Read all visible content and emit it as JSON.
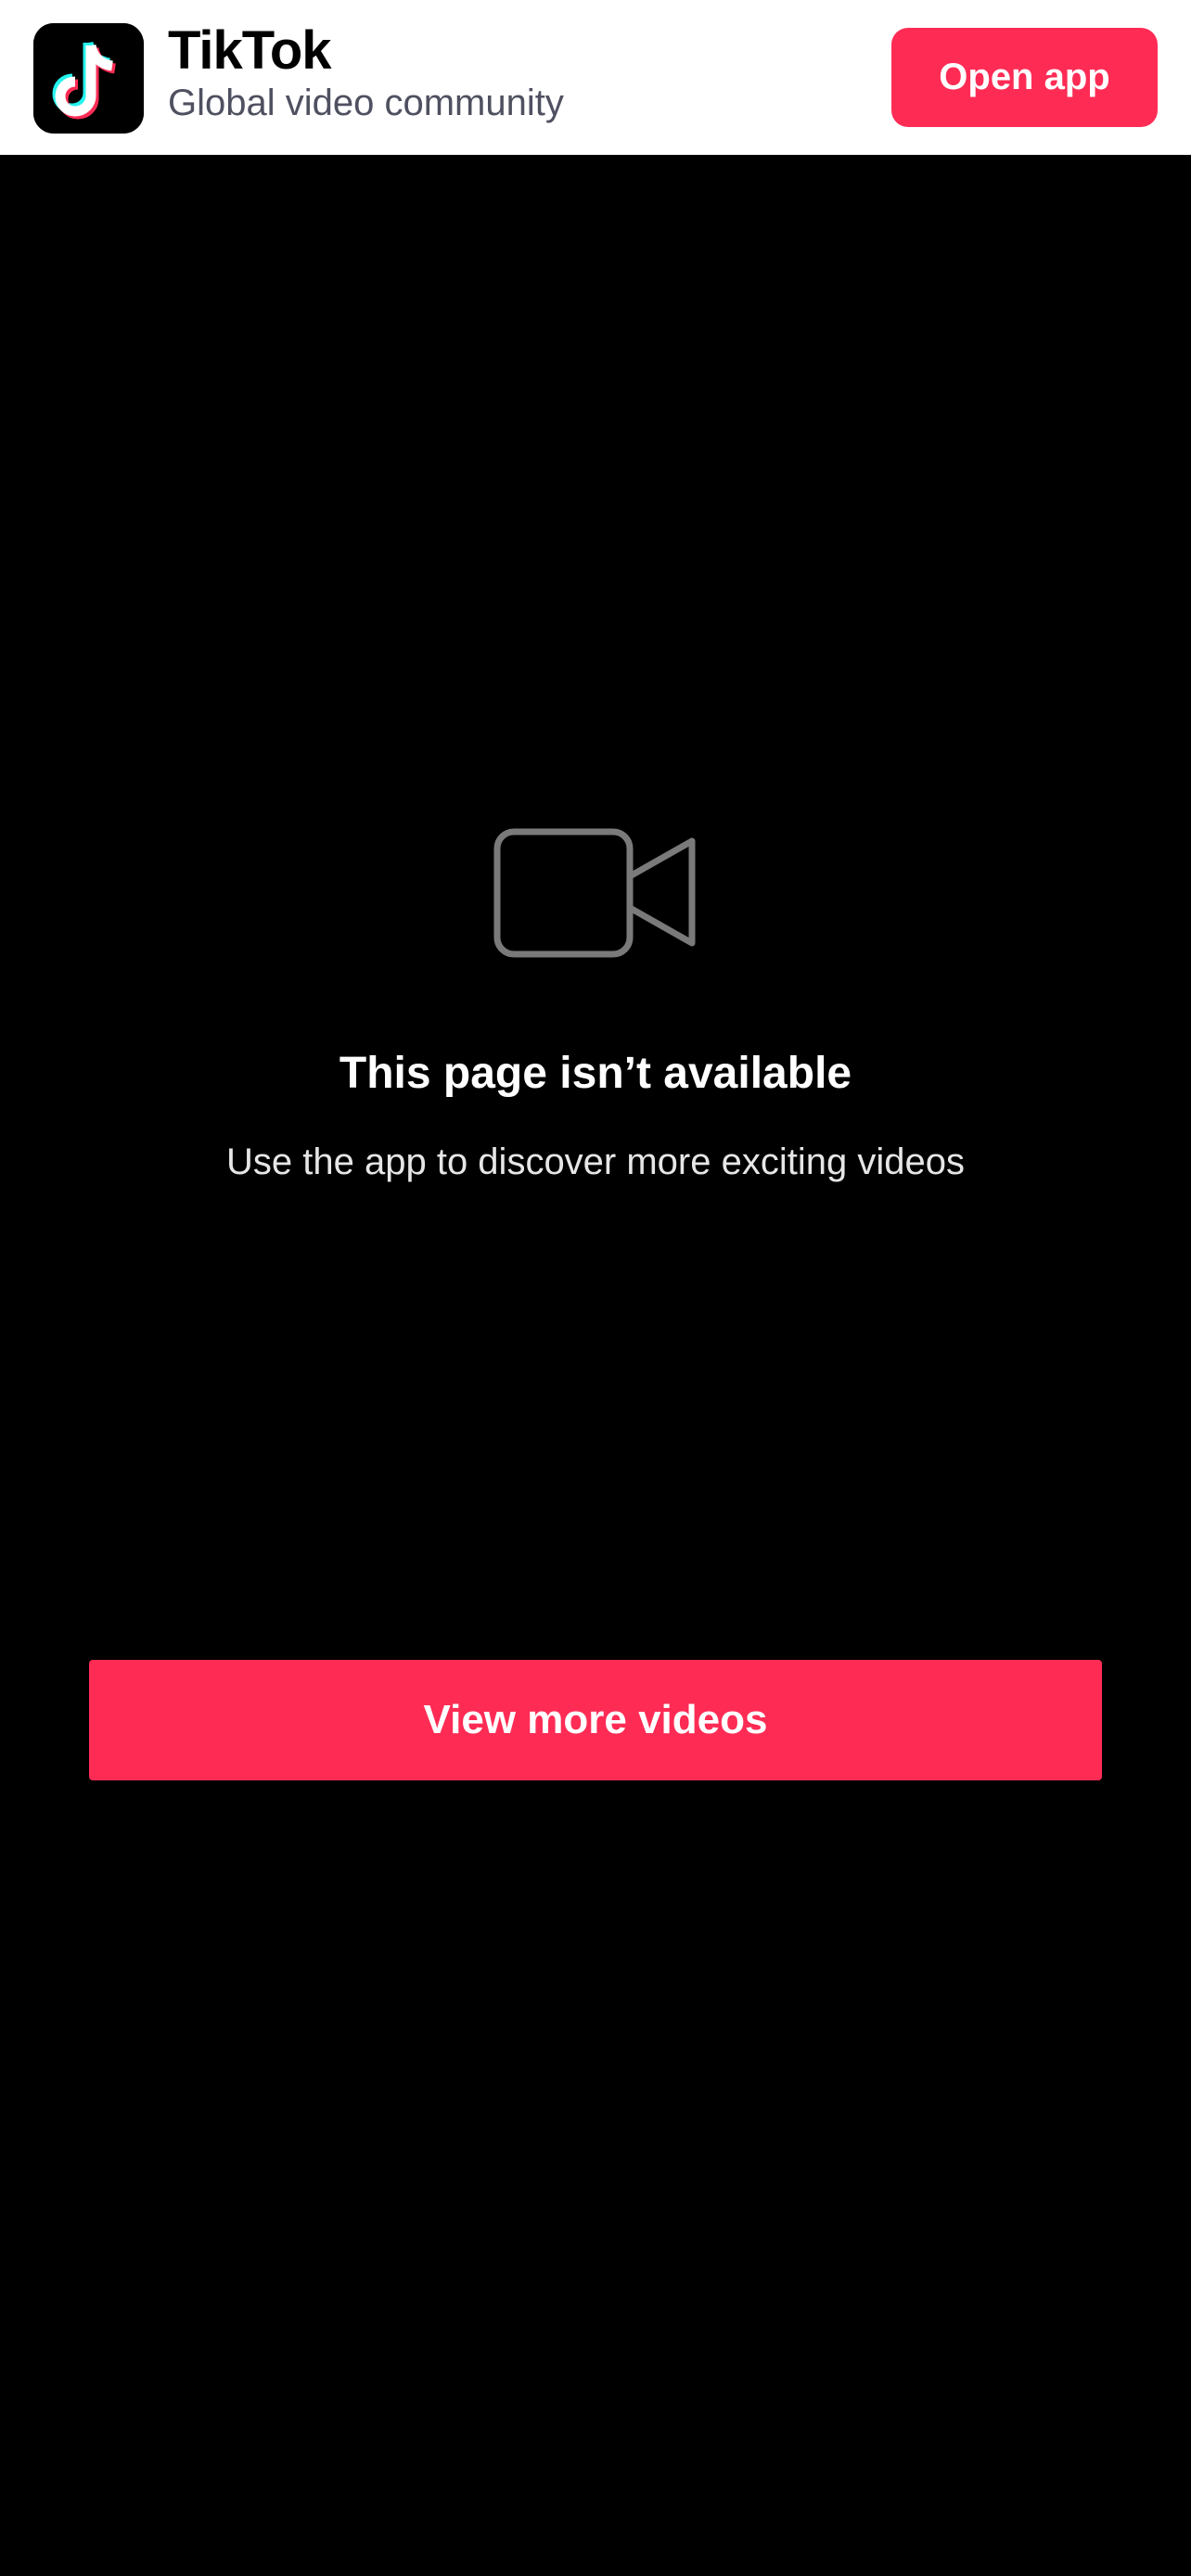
{
  "banner": {
    "logo_icon": "tiktok-logo-icon",
    "brand_name": "TikTok",
    "tagline": "Global video community",
    "open_app_label": "Open app"
  },
  "empty_state": {
    "icon": "video-camera-icon",
    "title": "This page isn’t available",
    "subtitle": "Use the app to discover more exciting videos"
  },
  "cta": {
    "view_more_label": "View more videos"
  },
  "colors": {
    "accent": "#fe2c55",
    "background": "#000000",
    "banner_background": "#ffffff",
    "tagline_text": "#4f5060",
    "icon_stroke": "#7a7a7a",
    "logo_cyan": "#25f4ee",
    "logo_red": "#fe2c55"
  }
}
